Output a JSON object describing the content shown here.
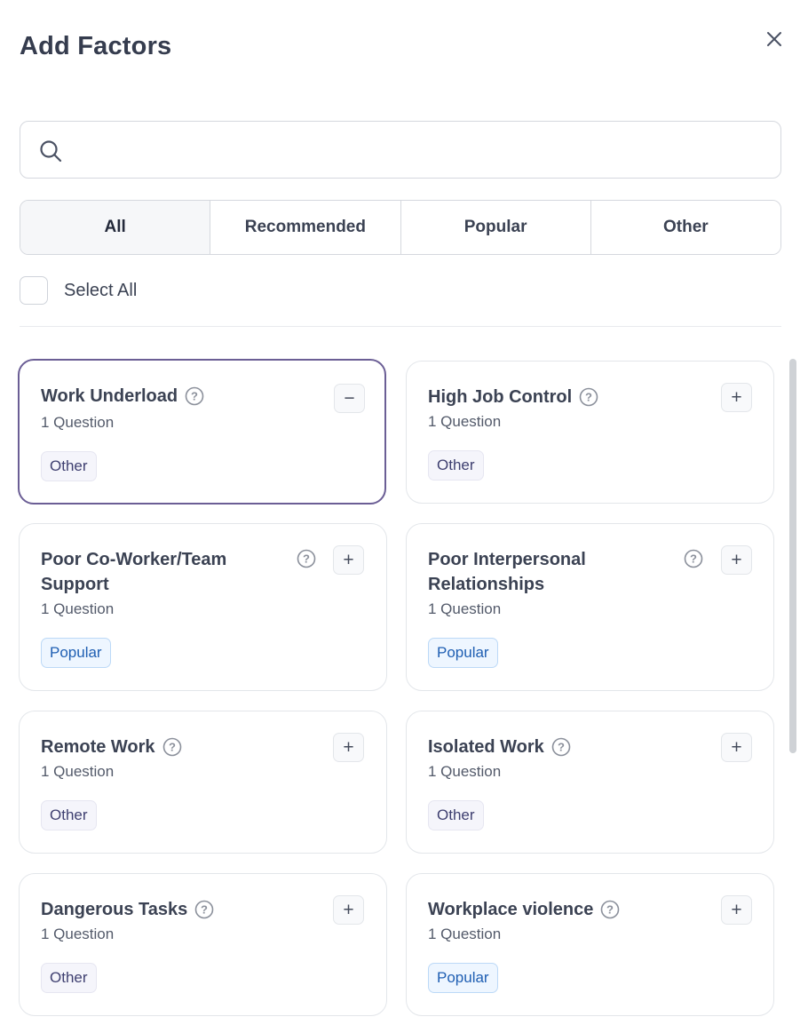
{
  "dialog": {
    "title": "Add Factors",
    "close_icon": "close-icon"
  },
  "search": {
    "value": "",
    "placeholder": "",
    "icon": "search-icon"
  },
  "tabs": [
    {
      "label": "All",
      "active": true
    },
    {
      "label": "Recommended",
      "active": false
    },
    {
      "label": "Popular",
      "active": false
    },
    {
      "label": "Other",
      "active": false
    }
  ],
  "select_all": {
    "label": "Select All",
    "checked": false
  },
  "factors": [
    {
      "title": "Work Underload",
      "subtitle": "1 Question",
      "badge": "Other",
      "selected": true,
      "action": "−"
    },
    {
      "title": "High Job Control",
      "subtitle": "1 Question",
      "badge": "Other",
      "selected": false,
      "action": "+"
    },
    {
      "title": "Poor Co-Worker/Team Support",
      "subtitle": "1 Question",
      "badge": "Popular",
      "selected": false,
      "action": "+"
    },
    {
      "title": "Poor Interpersonal Relationships",
      "subtitle": "1 Question",
      "badge": "Popular",
      "selected": false,
      "action": "+"
    },
    {
      "title": "Remote Work",
      "subtitle": "1 Question",
      "badge": "Other",
      "selected": false,
      "action": "+"
    },
    {
      "title": "Isolated Work",
      "subtitle": "1 Question",
      "badge": "Other",
      "selected": false,
      "action": "+"
    },
    {
      "title": "Dangerous Tasks",
      "subtitle": "1 Question",
      "badge": "Other",
      "selected": false,
      "action": "+"
    },
    {
      "title": "Workplace violence",
      "subtitle": "1 Question",
      "badge": "Popular",
      "selected": false,
      "action": "+"
    }
  ],
  "colors": {
    "selected_border": "#6b5e95",
    "popular_badge_text": "#1f5fb3",
    "other_badge_text": "#3e3f70"
  }
}
